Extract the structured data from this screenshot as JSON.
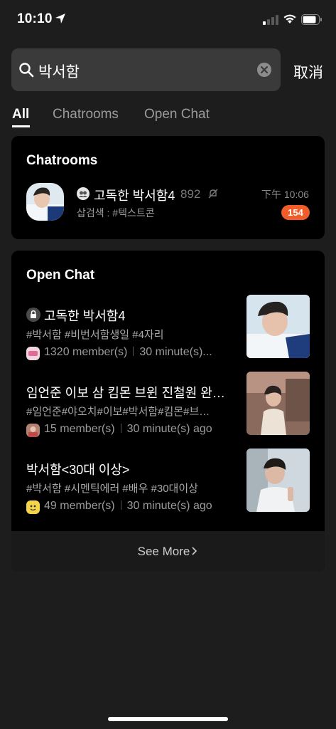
{
  "status_bar": {
    "time": "10:10"
  },
  "search": {
    "value": "박서함",
    "cancel_label": "取消"
  },
  "tabs": [
    {
      "label": "All",
      "active": true
    },
    {
      "label": "Chatrooms",
      "active": false
    },
    {
      "label": "Open Chat",
      "active": false
    }
  ],
  "chatrooms": {
    "title": "Chatrooms",
    "items": [
      {
        "name": "고독한 박서함4",
        "member_count": "892",
        "subtitle": "삽검색 : #텍스트콘",
        "time": "下午 10:06",
        "unread": "154",
        "muted": true
      }
    ]
  },
  "open_chat": {
    "title": "Open Chat",
    "items": [
      {
        "title": "고독한 박서함4",
        "locked": true,
        "tags": "#박서함 #비번서함생일 #4자리",
        "members": "1320 member(s)",
        "last_active": "30 minute(s)..."
      },
      {
        "title": "임언준 이보 삼 킴몬 브윈 진철원 완…",
        "locked": false,
        "tags": "#임언준#야오치#이보#박서함#킴몬#브…",
        "members": "15 member(s)",
        "last_active": "30 minute(s) ago"
      },
      {
        "title": "박서함<30대 이상>",
        "locked": false,
        "tags": "#박서함 #시멘틱에러 #배우 #30대이상",
        "members": "49 member(s)",
        "last_active": "30 minute(s) ago"
      }
    ],
    "see_more_label": "See More"
  },
  "colors": {
    "background": "#1d1d1d",
    "card": "#000000",
    "badge": "#f05d2a",
    "search_field": "#3a3a3a"
  },
  "icons": [
    "location-arrow-icon",
    "signal-icon",
    "wifi-icon",
    "battery-icon",
    "search-icon",
    "clear-icon",
    "group-chat-icon",
    "mute-icon",
    "lock-icon",
    "chevron-right-icon"
  ]
}
